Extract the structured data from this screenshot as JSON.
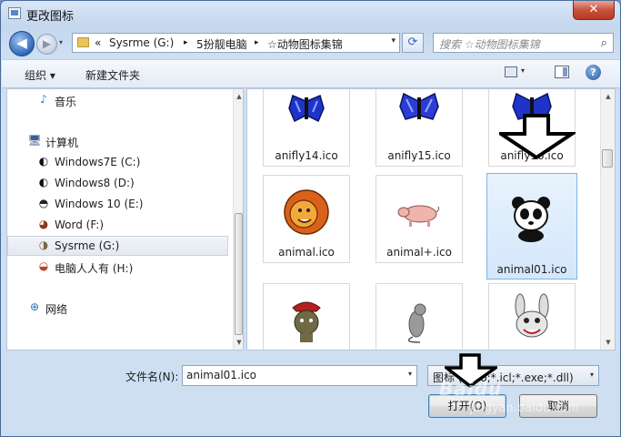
{
  "window": {
    "title": "更改图标",
    "close_glyph": "✕"
  },
  "navigation": {
    "back_glyph": "◀",
    "forward_glyph": "▶",
    "recent_glyph": "▾",
    "address": {
      "overflow": "«",
      "crumbs": [
        "Sysrme (G:)",
        "5扮靓电脑",
        "☆动物图标集锦"
      ],
      "separator": "▸",
      "dropdown_glyph": "▾"
    },
    "refresh_glyph": "⟳",
    "search": {
      "placeholder": "搜索 ☆动物图标集锦",
      "icon": "search-icon",
      "icon_glyph": "⌕"
    }
  },
  "toolbar": {
    "organize_label": "组织 ▾",
    "new_folder_label": "新建文件夹",
    "view_dropdown_glyph": "▾",
    "help_glyph": "?"
  },
  "nav_pane": {
    "items": [
      {
        "label": "音乐",
        "icon": "music-note-icon",
        "glyph": "♪",
        "color": "#2a7bd6",
        "selected": false
      },
      {
        "label": "计算机",
        "icon": "computer-icon",
        "glyph": "🖥",
        "color": "#3a5f8f",
        "selected": false
      },
      {
        "label": "Windows7E (C:)",
        "icon": "drive-panda-icon",
        "glyph": "◐",
        "color": "#111111",
        "selected": false
      },
      {
        "label": "Windows8 (D:)",
        "icon": "drive-panda-icon",
        "glyph": "◐",
        "color": "#111111",
        "selected": false
      },
      {
        "label": "Windows 10 (E:)",
        "icon": "drive-penguin-icon",
        "glyph": "◓",
        "color": "#222222",
        "selected": false
      },
      {
        "label": "Word (F:)",
        "icon": "drive-monkey-icon",
        "glyph": "◕",
        "color": "#8a3a1a",
        "selected": false
      },
      {
        "label": "Sysrme (G:)",
        "icon": "drive-dog-icon",
        "glyph": "◑",
        "color": "#7a6a3a",
        "selected": true
      },
      {
        "label": "电脑人人有 (H:)",
        "icon": "drive-cat-icon",
        "glyph": "◒",
        "color": "#b8442a",
        "selected": false
      },
      {
        "label": "网络",
        "icon": "network-icon",
        "glyph": "⊕",
        "color": "#2d6db5",
        "selected": false
      }
    ],
    "scroll_up_glyph": "▲",
    "scroll_down_glyph": "▼"
  },
  "files": [
    {
      "name": "anifly14.ico",
      "icon": "blue-butterfly-icon",
      "selected": false
    },
    {
      "name": "anifly15.ico",
      "icon": "blue-butterfly-icon",
      "selected": false
    },
    {
      "name": "anifly16.ico",
      "icon": "blue-butterfly-icon",
      "selected": false
    },
    {
      "name": "animal.ico",
      "icon": "lion-icon",
      "selected": false
    },
    {
      "name": "animal+.ico",
      "icon": "pig-icon",
      "selected": false
    },
    {
      "name": "animal01.ico",
      "icon": "panda-icon",
      "selected": true
    },
    {
      "name": "",
      "icon": "cowboy-mouse-icon",
      "selected": false
    },
    {
      "name": "",
      "icon": "rat-icon",
      "selected": false
    },
    {
      "name": "",
      "icon": "rabbit-icon",
      "selected": false
    }
  ],
  "footer": {
    "filename_label": "文件名(N):",
    "filename_value": "animal01.ico",
    "filename_dropdown_glyph": "▾",
    "filetype_value": "图标 (*.ico;*.icl;*.exe;*.dll)",
    "filetype_dropdown_glyph": "▾",
    "open_label": "打开(O)",
    "cancel_label": "取消"
  },
  "annotations": {
    "watermark": "Baidu",
    "watermark_sub": "jingyan.baidu.com"
  }
}
